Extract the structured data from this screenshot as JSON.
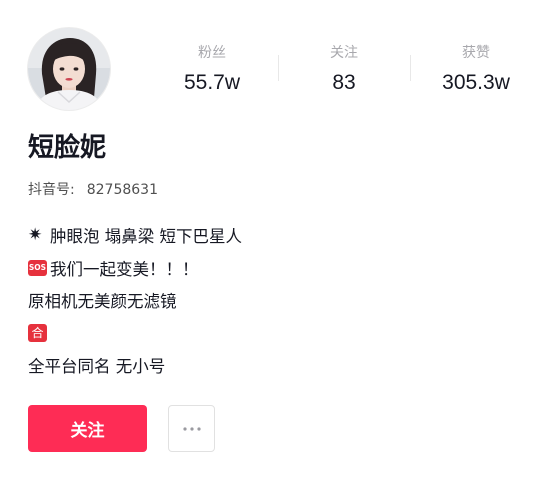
{
  "profile": {
    "nickname": "短脸妮",
    "id_label": "抖音号:",
    "id_value": "82758631"
  },
  "stats": [
    {
      "label": "粉丝",
      "value": "55.7w"
    },
    {
      "label": "关注",
      "value": "83"
    },
    {
      "label": "获赞",
      "value": "305.3w"
    }
  ],
  "bio": {
    "line1_icon": "sparkle-icon",
    "line1_text": "肿眼泡 塌鼻梁 短下巴星人",
    "line2_icon": "sos-emoji",
    "line2_icon_text": "SOS",
    "line2_text": "我们一起变美！！！",
    "line3_text": "原相机无美颜无滤镜",
    "line4_icon": "he-emoji",
    "line4_icon_text": "合",
    "line5_text": "全平台同名 无小号"
  },
  "actions": {
    "follow_label": "关注",
    "more_icon": "more-dots-icon"
  },
  "colors": {
    "accent": "#fe2c55",
    "emoji_red": "#e6313d",
    "muted_text": "#a8a8ad"
  }
}
